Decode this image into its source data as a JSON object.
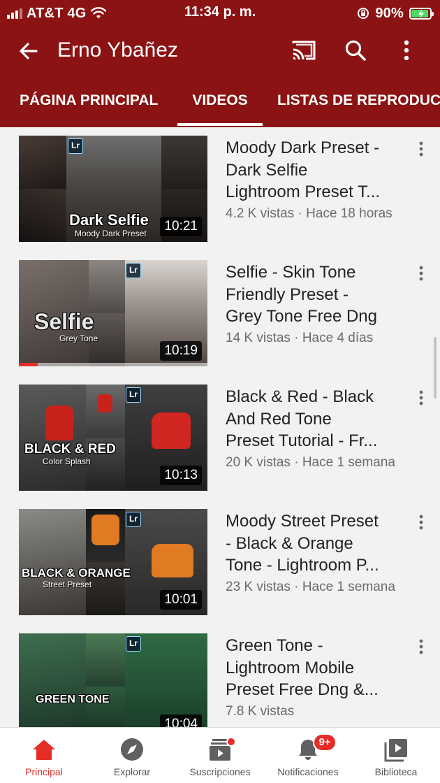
{
  "status_bar": {
    "carrier": "AT&T 4G",
    "time": "11:34 p. m.",
    "battery": "90%"
  },
  "app_bar": {
    "title": "Erno Ybañez",
    "icons": [
      "back-arrow-icon",
      "cast-icon",
      "search-icon",
      "more-vert-icon"
    ]
  },
  "tabs": [
    {
      "label": "PÁGINA PRINCIPAL",
      "selected": false
    },
    {
      "label": "VIDEOS",
      "selected": true
    },
    {
      "label": "LISTAS DE REPRODUC",
      "selected": false
    }
  ],
  "videos": [
    {
      "title_lines": [
        "Moody Dark Preset -",
        "Dark Selfie",
        "Lightroom Preset T..."
      ],
      "meta": "4.2 K vistas · Hace 18 horas",
      "duration": "10:21",
      "thumb_title": "Dark Selfie",
      "thumb_subtitle": "Moody Dark Preset",
      "badge": "Lr",
      "watched_fraction": 0
    },
    {
      "title_lines": [
        "Selfie - Skin Tone",
        "Friendly Preset -",
        "Grey Tone Free Dng"
      ],
      "meta": "14 K vistas · Hace 4 días",
      "duration": "10:19",
      "thumb_title": "Selfie",
      "thumb_subtitle": "Grey Tone",
      "badge": "Lr",
      "watched_fraction": 0.1
    },
    {
      "title_lines": [
        "Black & Red - Black",
        "And Red Tone",
        "Preset Tutorial - Fr..."
      ],
      "meta": "20 K vistas · Hace 1 semana",
      "duration": "10:13",
      "thumb_title": "BLACK & RED",
      "thumb_subtitle": "Color Splash",
      "badge": "Lr",
      "watched_fraction": 0
    },
    {
      "title_lines": [
        "Moody Street Preset",
        "- Black & Orange",
        "Tone - Lightroom P..."
      ],
      "meta": "23 K vistas · Hace 1 semana",
      "duration": "10:01",
      "thumb_title": "BLACK & ORANGE",
      "thumb_subtitle": "Street Preset",
      "badge": "Lr",
      "watched_fraction": 0
    },
    {
      "title_lines": [
        "Green Tone -",
        "Lightroom Mobile",
        "Preset Free Dng &..."
      ],
      "meta": "7.8 K vistas",
      "duration": "10:04",
      "thumb_title": "GREEN TONE",
      "thumb_subtitle": "",
      "badge": "Lr",
      "watched_fraction": 0
    }
  ],
  "bottom_nav": [
    {
      "label": "Principal",
      "icon": "home-icon",
      "active": true
    },
    {
      "label": "Explorar",
      "icon": "compass-icon",
      "active": false
    },
    {
      "label": "Suscripciones",
      "icon": "subscriptions-icon",
      "active": false
    },
    {
      "label": "Notificaciones",
      "icon": "bell-icon",
      "active": false,
      "badge": "9+"
    },
    {
      "label": "Biblioteca",
      "icon": "library-icon",
      "active": false
    }
  ],
  "colors": {
    "brand_bar": "#8b1313",
    "accent_red": "#e52d27",
    "background": "#f2f2f2",
    "text_primary": "#222222",
    "text_secondary": "#6b6b6b"
  }
}
